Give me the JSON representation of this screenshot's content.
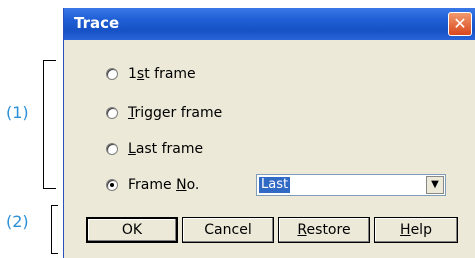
{
  "callouts": {
    "group1": "(1)",
    "group2": "(2)"
  },
  "window": {
    "title": "Trace",
    "close_glyph": "✕"
  },
  "radios": [
    {
      "pre": "1",
      "ul": "s",
      "post": "t frame",
      "checked": false
    },
    {
      "pre": "",
      "ul": "T",
      "post": "rigger frame",
      "checked": false
    },
    {
      "pre": "",
      "ul": "L",
      "post": "ast frame",
      "checked": false
    },
    {
      "pre": "Frame ",
      "ul": "N",
      "post": "o.",
      "checked": true
    }
  ],
  "frame_select": {
    "value": "Last",
    "arrow_glyph": "▼"
  },
  "buttons": {
    "ok": "OK",
    "cancel": "Cancel",
    "restore": {
      "ul": "R",
      "post": "estore"
    },
    "help": {
      "ul": "H",
      "post": "elp"
    }
  }
}
